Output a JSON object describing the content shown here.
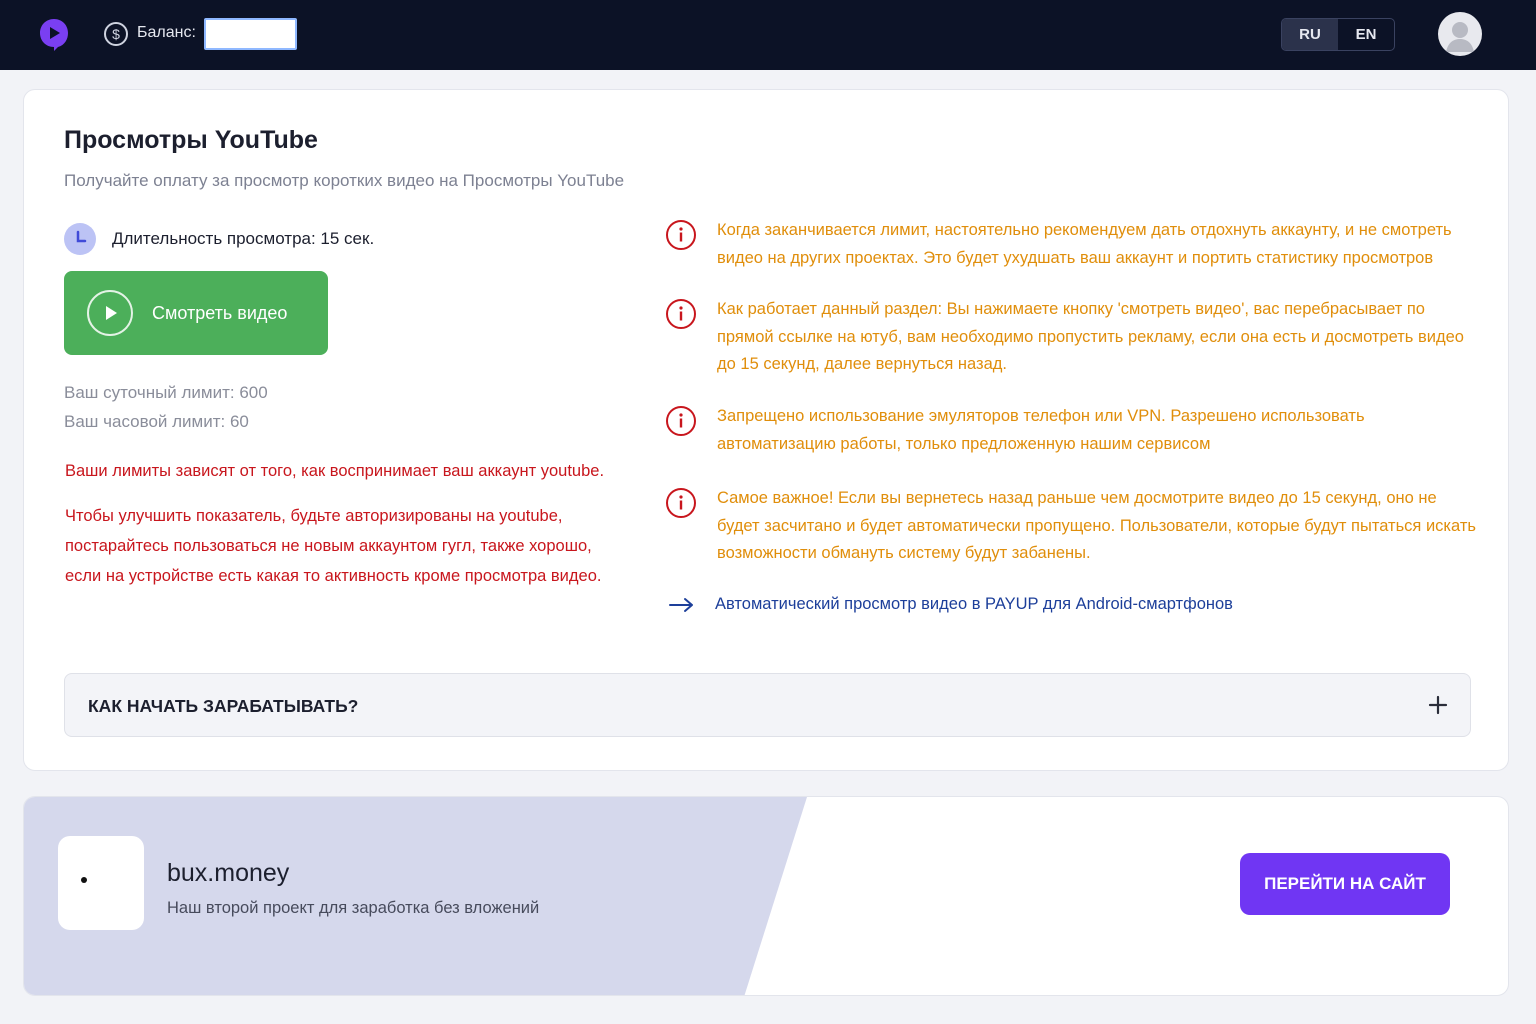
{
  "header": {
    "balance_label": "Баланс:",
    "balance_value": "",
    "languages": [
      {
        "label": "RU",
        "active": true
      },
      {
        "label": "EN",
        "active": false
      }
    ],
    "logo_icon": "play-logo-icon",
    "balance_icon": "dollar-coin-icon",
    "avatar_icon": "user-avatar-icon"
  },
  "main": {
    "title": "Просмотры YouTube",
    "subtitle": "Получайте оплату за просмотр коротких видео на Просмотры YouTube",
    "duration_text": "Длительность просмотра: 15 сек.",
    "watch_button_label": "Смотреть видео",
    "daily_limit": "Ваш суточный лимит: 600",
    "hourly_limit": "Ваш часовой лимит: 60",
    "warning_limits": "Ваши лимиты зависят от того, как воспринимает ваш аккаунт youtube.",
    "improve_tips": [
      "Чтобы улучшить показатель, будьте авторизированы на youtube,",
      "постарайтесь пользоваться не новым аккаунтом гугл, также хорошо,",
      "если на устройстве есть какая то активность кроме просмотра видео."
    ],
    "info_items": [
      {
        "text": "Когда заканчивается лимит, настоятельно рекомендуем дать отдохнуть аккаунту, и не смотреть видео на других проектах. Это будет ухудшать ваш аккаунт и портить статистику просмотров"
      },
      {
        "text": "Как работает данный раздел: Вы нажимаете кнопку 'смотреть видео', вас перебрасывает по прямой ссылке на ютуб, вам необходимо пропустить рекламу, если она есть и досмотреть видео до 15 секунд, далее вернуться назад."
      },
      {
        "text": "Запрещено использование эмуляторов телефон или VPN. Разрешено использовать автоматизацию работы, только предложенную нашим сервисом"
      },
      {
        "text": "Самое важное! Если вы вернетесь назад раньше чем досмотрите видео до 15 секунд, оно не будет засчитано и будет автоматически пропущено. Пользователи, которые будут пытаться искать возможности обмануть систему будут забанены."
      }
    ],
    "android_link": "Автоматический просмотр видео в PAYUP для Android-смартфонов",
    "faq_title": "КАК НАЧАТЬ ЗАРАБАТЫВАТЬ?",
    "colors": {
      "accent_green": "#4caf5a",
      "warning_orange": "#e08e0b",
      "alert_red": "#c8161d",
      "link_blue": "#1d3f9a"
    }
  },
  "promo": {
    "title": "bux.money",
    "subtitle": "Наш второй проект для заработка без вложений",
    "button_label": "ПЕРЕЙТИ НА САЙТ",
    "button_color": "#7036f3"
  }
}
